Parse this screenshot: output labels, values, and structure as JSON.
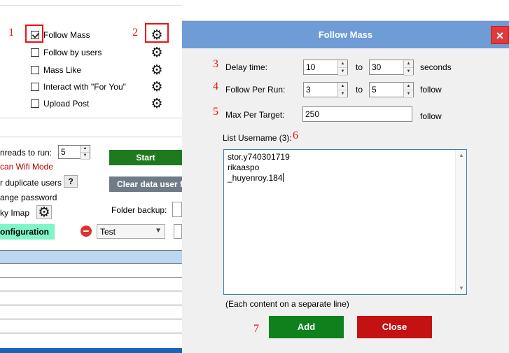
{
  "background": {
    "tasks": [
      {
        "label": "Follow Mass",
        "checked": true
      },
      {
        "label": "Follow by users",
        "checked": false
      },
      {
        "label": "Mass Like",
        "checked": false
      },
      {
        "label": "Interact with \"For You\"",
        "checked": false
      },
      {
        "label": "Upload Post",
        "checked": false
      }
    ],
    "threads_label": "nreads to run:",
    "threads_value": "5",
    "scan_wifi_label": "can Wifi Mode",
    "duplicate_users_label": "r duplicate users",
    "help_label": "?",
    "change_password_label": "ange password",
    "imap_label": "ky Imap",
    "folder_backup_label": "Folder backup:",
    "start_label": "Start",
    "clear_label": "Clear data user f",
    "config_label": "onfiguration",
    "profile_select_value": "Test"
  },
  "markers": [
    "1",
    "2",
    "3",
    "4",
    "5",
    "6",
    "7"
  ],
  "dialog": {
    "title": "Follow Mass",
    "close_icon": "×",
    "delay_label": "Delay time:",
    "delay_from": "10",
    "delay_to": "30",
    "delay_to_word": "to",
    "delay_unit": "seconds",
    "per_run_label": "Follow Per Run:",
    "per_run_from": "3",
    "per_run_to": "5",
    "per_run_to_word": "to",
    "per_run_unit": "follow",
    "max_target_label": "Max Per Target:",
    "max_target_value": "250",
    "max_target_unit": "follow",
    "list_label": "List Username (3):",
    "usernames": [
      "stor.y740301719",
      "rikaaspo",
      "_huyenroy.184"
    ],
    "hint": "(Each content on a separate line)",
    "add_label": "Add",
    "close_label": "Close"
  },
  "colors": {
    "title_bar": "#6f9bd6",
    "add_button": "#10801c",
    "close_button": "#c41212",
    "start_button": "#1f7a1f",
    "annotation_red": "#e11111"
  }
}
